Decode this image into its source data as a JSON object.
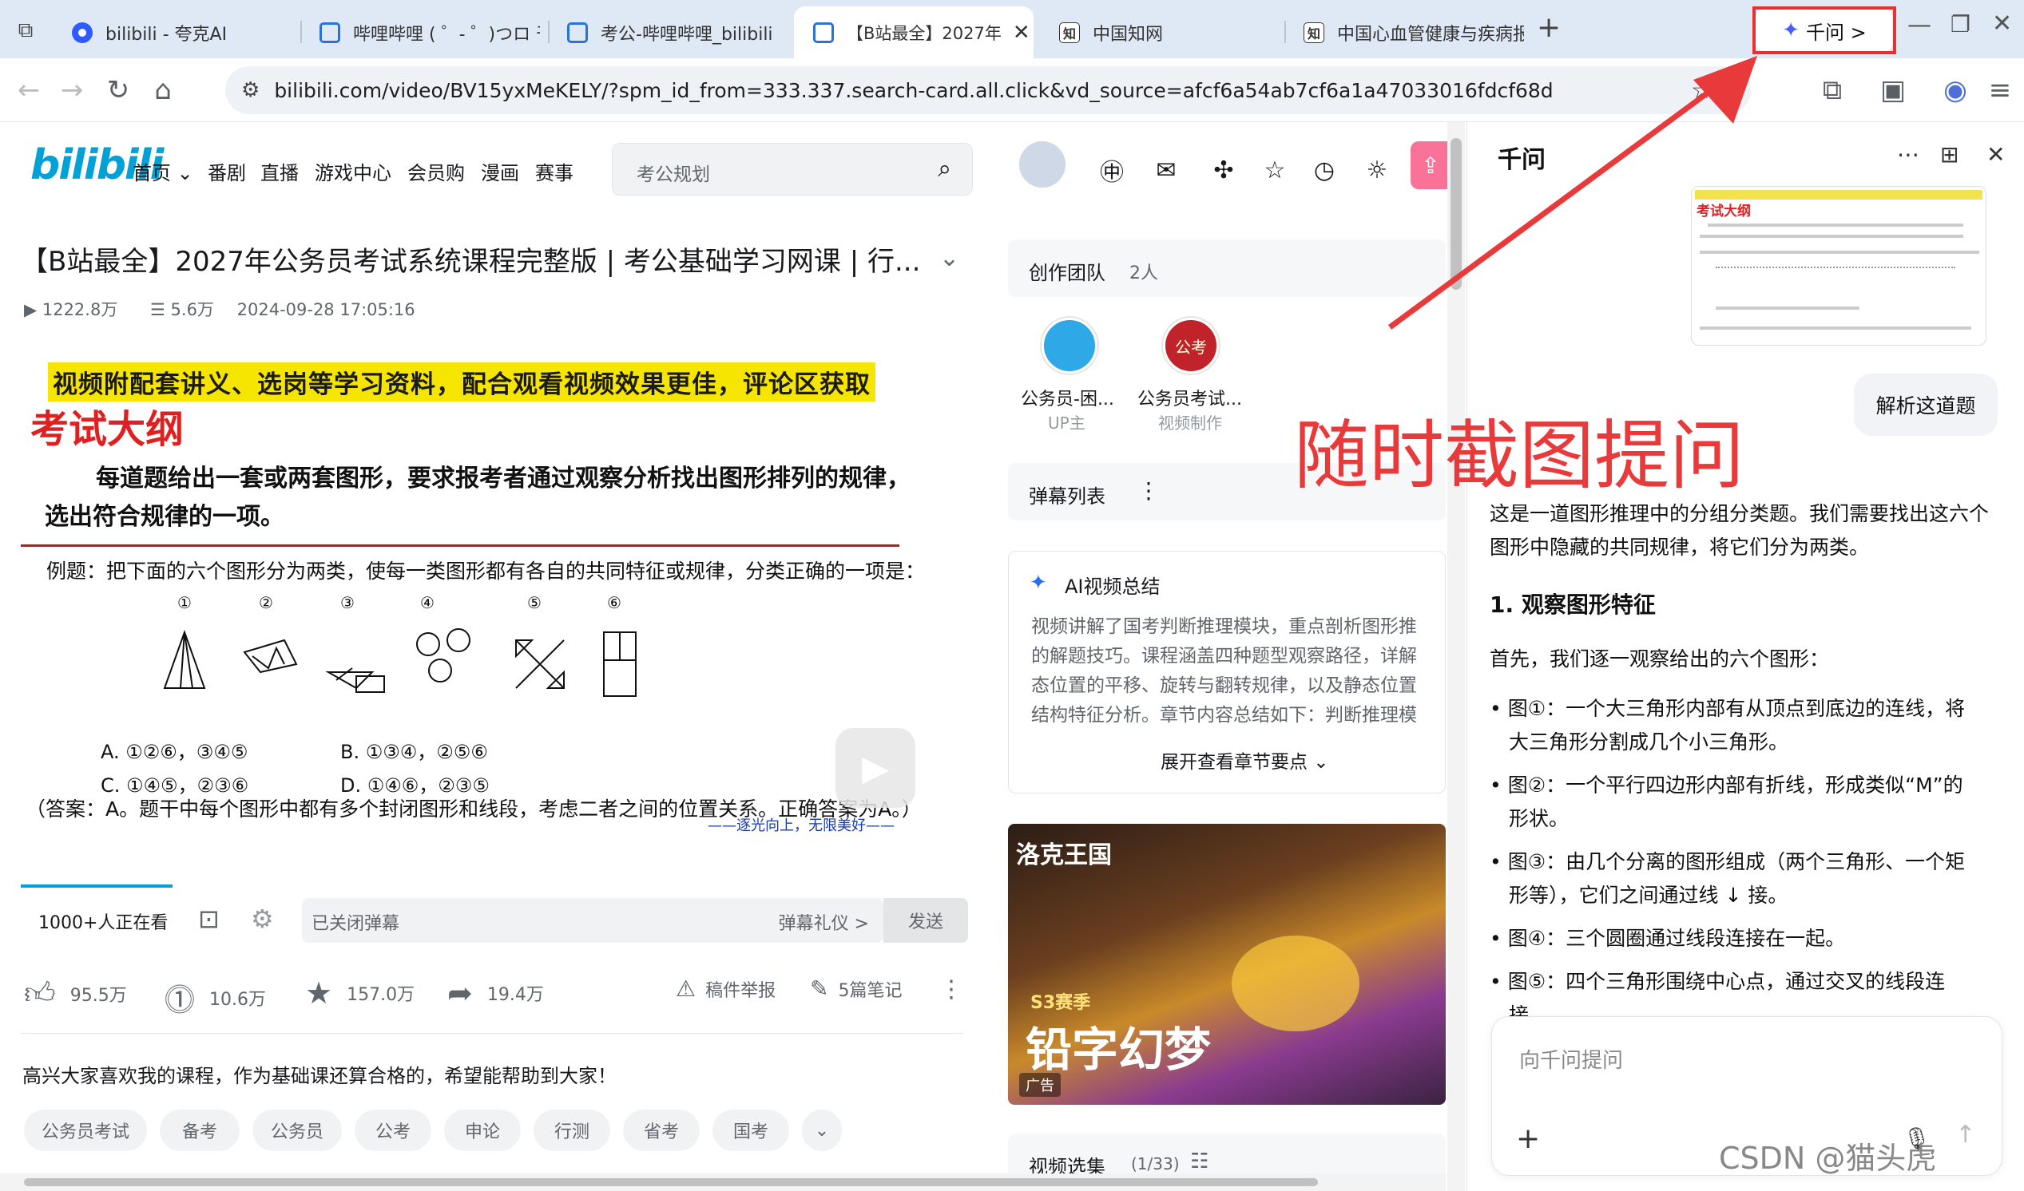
{
  "browser": {
    "tabs": [
      {
        "label": "bilibili - 夸克AI",
        "icon": "quark-icon",
        "active": false
      },
      {
        "label": "哔哩哔哩 ( ゜- ゜)つロ 干",
        "icon": "bilibili-tv-icon",
        "active": false
      },
      {
        "label": "考公-哔哩哔哩_bilibili",
        "icon": "bilibili-tv-icon",
        "active": false
      },
      {
        "label": "【B站最全】2027年",
        "icon": "bilibili-tv-icon",
        "active": true
      },
      {
        "label": "中国知网",
        "icon": "cnki-icon",
        "active": false
      },
      {
        "label": "中国心血管健康与疾病报",
        "icon": "cnki-icon",
        "active": false
      }
    ],
    "qianwen_button": "千问 >",
    "url": "bilibili.com/video/BV15yxMeKELY/?spm_id_from=333.337.search-card.all.click&vd_source=afcf6a54ab7cf6a1a47033016fdcf68d"
  },
  "bili": {
    "logo": "bilibili",
    "nav": [
      "首页",
      "番剧",
      "直播",
      "游戏中心",
      "会员购",
      "漫画",
      "赛事"
    ],
    "search_placeholder": "考公规划",
    "video_title": "【B站最全】2027年公务员考试系统课程完整版 | 考公基础学习网课 | 行...",
    "views": "1222.8万",
    "danmaku_count": "5.6万",
    "date": "2024-09-28 17:05:16",
    "video": {
      "banner": "视频附配套讲义、选岗等学习资料，配合观看视频效果更佳，评论区获取",
      "heading": "考试大纲",
      "line1": "每道题给出一套或两套图形，要求报考者通过观察分析找出图形排列的规律，",
      "line2": "选出符合规律的一项。",
      "example": "例题：把下面的六个图形分为两类，使每一类图形都有各自的共同特征或规律，分类正确的一项是：",
      "nums": [
        "①",
        "②",
        "③",
        "④",
        "⑤",
        "⑥"
      ],
      "optA": "A. ①②⑥，③④⑤",
      "optB": "B. ①③④，②⑤⑥",
      "optC": "C. ①④⑤，②③⑥",
      "optD": "D. ①④⑥，②③⑤",
      "answer": "（答案：A。题干中每个图形中都有多个封闭图形和线段，考虑二者之间的位置关系。正确答案为A。）",
      "sign": "——逐光向上，无限美好——"
    },
    "watching": "1000+人正在看",
    "danmu_placeholder": "已关闭弹幕",
    "danmu_etiquette": "弹幕礼仪 >",
    "send": "发送",
    "likes": "95.5万",
    "coins": "10.6万",
    "favs": "157.0万",
    "shares": "19.4万",
    "report": "稿件举报",
    "notes": "5篇笔记",
    "description": "高兴大家喜欢我的课程，作为基础课还算合格的，希望能帮助到大家！",
    "tags": [
      "公务员考试",
      "备考",
      "公务员",
      "公考",
      "申论",
      "行测",
      "省考",
      "国考"
    ],
    "sidebar": {
      "team_title": "创作团队",
      "team_count": "2人",
      "members": [
        {
          "name": "公务员-困...",
          "role": "UP主"
        },
        {
          "name": "公务员考试...",
          "role": "视频制作"
        }
      ],
      "danmaku_list": "弹幕列表",
      "ai_summary_title": "AI视频总结",
      "ai_summary_lines": [
        "视频讲解了国考判断推理模块，重点剖析图形推",
        "的解题技巧。课程涵盖四种题型观察路径，详解",
        "态位置的平移、旋转与翻转规律，以及静态位置",
        "结构特征分析。章节内容总结如下：判断推理模"
      ],
      "expand": "展开查看章节要点",
      "ad_title": "洛克王国",
      "ad_badge": "S3赛季",
      "ad_slogan": "铅字幻梦",
      "ad_label": "广告",
      "playlist": "视频选集",
      "playlist_count": "(1/33)"
    }
  },
  "qianwen": {
    "title": "千问",
    "thumb_heading": "考试大纲",
    "ask_chip": "解析这道题",
    "answer_intro": [
      "这是一道图形推理中的分组分类题。我们需要找出这六个",
      "图形中隐藏的共同规律，将它们分为两类。"
    ],
    "section1": "1. 观察图形特征",
    "section1_intro": "首先，我们逐一观察给出的六个图形：",
    "bullets": [
      [
        "图①：一个大三角形内部有从顶点到底边的连线，将",
        "大三角形分割成几个小三角形。"
      ],
      [
        "图②：一个平行四边形内部有折线，形成类似“M”的",
        "形状。"
      ],
      [
        "图③：由几个分离的图形组成（两个三角形、一个矩",
        "形等），它们之间通过线 ↓ 接。"
      ],
      [
        "图④：三个圆圈通过线段连接在一起。"
      ],
      [
        "图⑤：四个三角形围绕中心点，通过交叉的线段连",
        "接。"
      ]
    ],
    "input_placeholder": "向千问提问"
  },
  "annotation": "随时截图提问",
  "watermark": "CSDN @猫头虎"
}
